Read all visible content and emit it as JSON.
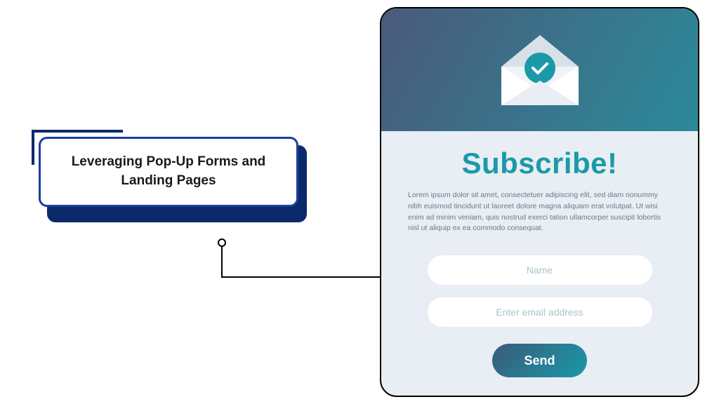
{
  "title_card": {
    "text": "Leveraging Pop-Up Forms and Landing Pages"
  },
  "subscribe": {
    "heading": "Subscribe!",
    "description": "Lorem ipsum dolor sit amet, consectetuer adipiscing elit, sed diam nonummy nibh euismod tincidunt ut laoreet dolore magna aliquam erat volutpat. Ut wisi enim ad minim veniam, quis nostrud exerci tation ullamcorper suscipit lobortis nisl ut aliquip ex ea commodo consequat.",
    "name_placeholder": "Name",
    "email_placeholder": "Enter email address",
    "send_label": "Send"
  }
}
